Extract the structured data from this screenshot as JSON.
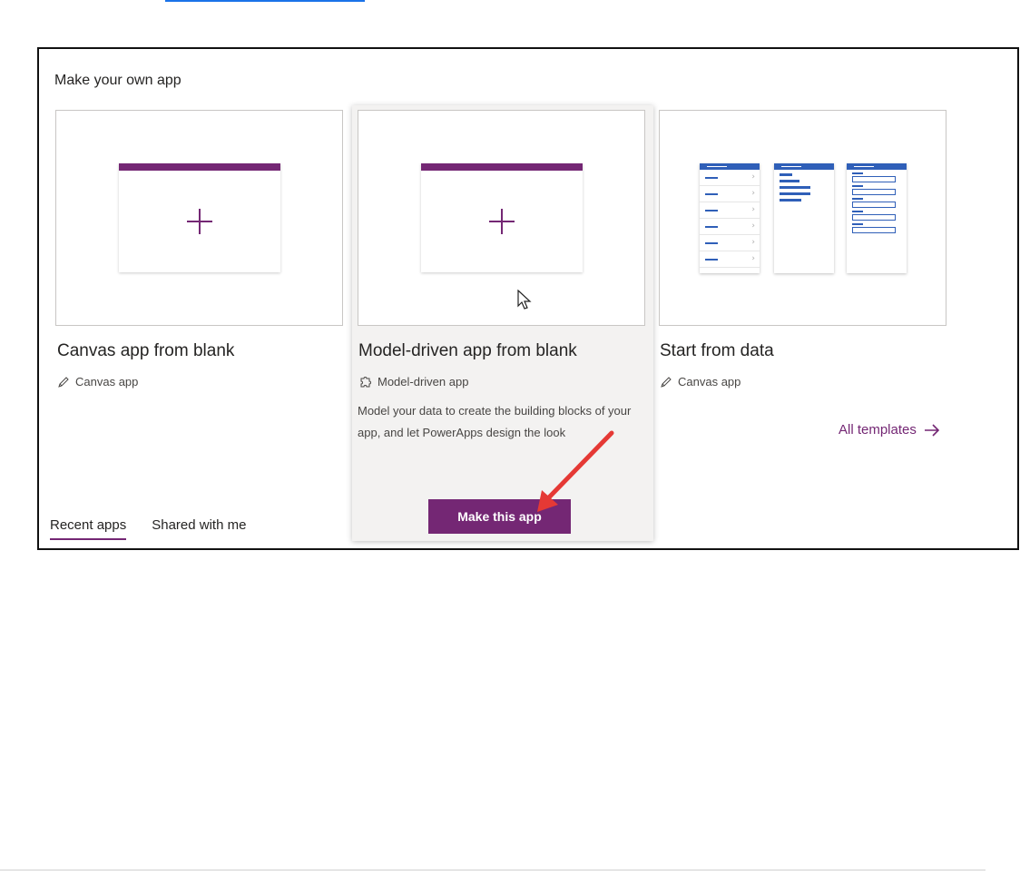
{
  "panel": {
    "title": "Make your own app"
  },
  "cards": [
    {
      "title": "Canvas app from blank",
      "type_label": "Canvas app",
      "type_icon": "pencil-icon"
    },
    {
      "title": "Model-driven app from blank",
      "type_label": "Model-driven app",
      "type_icon": "puzzle-icon",
      "description": "Model your data to create the building blocks of your app, and let PowerApps design the look",
      "button_label": "Make this app"
    },
    {
      "title": "Start from data",
      "type_label": "Canvas app",
      "type_icon": "pencil-icon"
    }
  ],
  "links": {
    "all_templates": "All templates"
  },
  "tabs": [
    {
      "label": "Recent apps",
      "active": true
    },
    {
      "label": "Shared with me",
      "active": false
    }
  ],
  "colors": {
    "accent": "#742774",
    "data_blue": "#2f5fb8",
    "annotation_red": "#e53935"
  }
}
